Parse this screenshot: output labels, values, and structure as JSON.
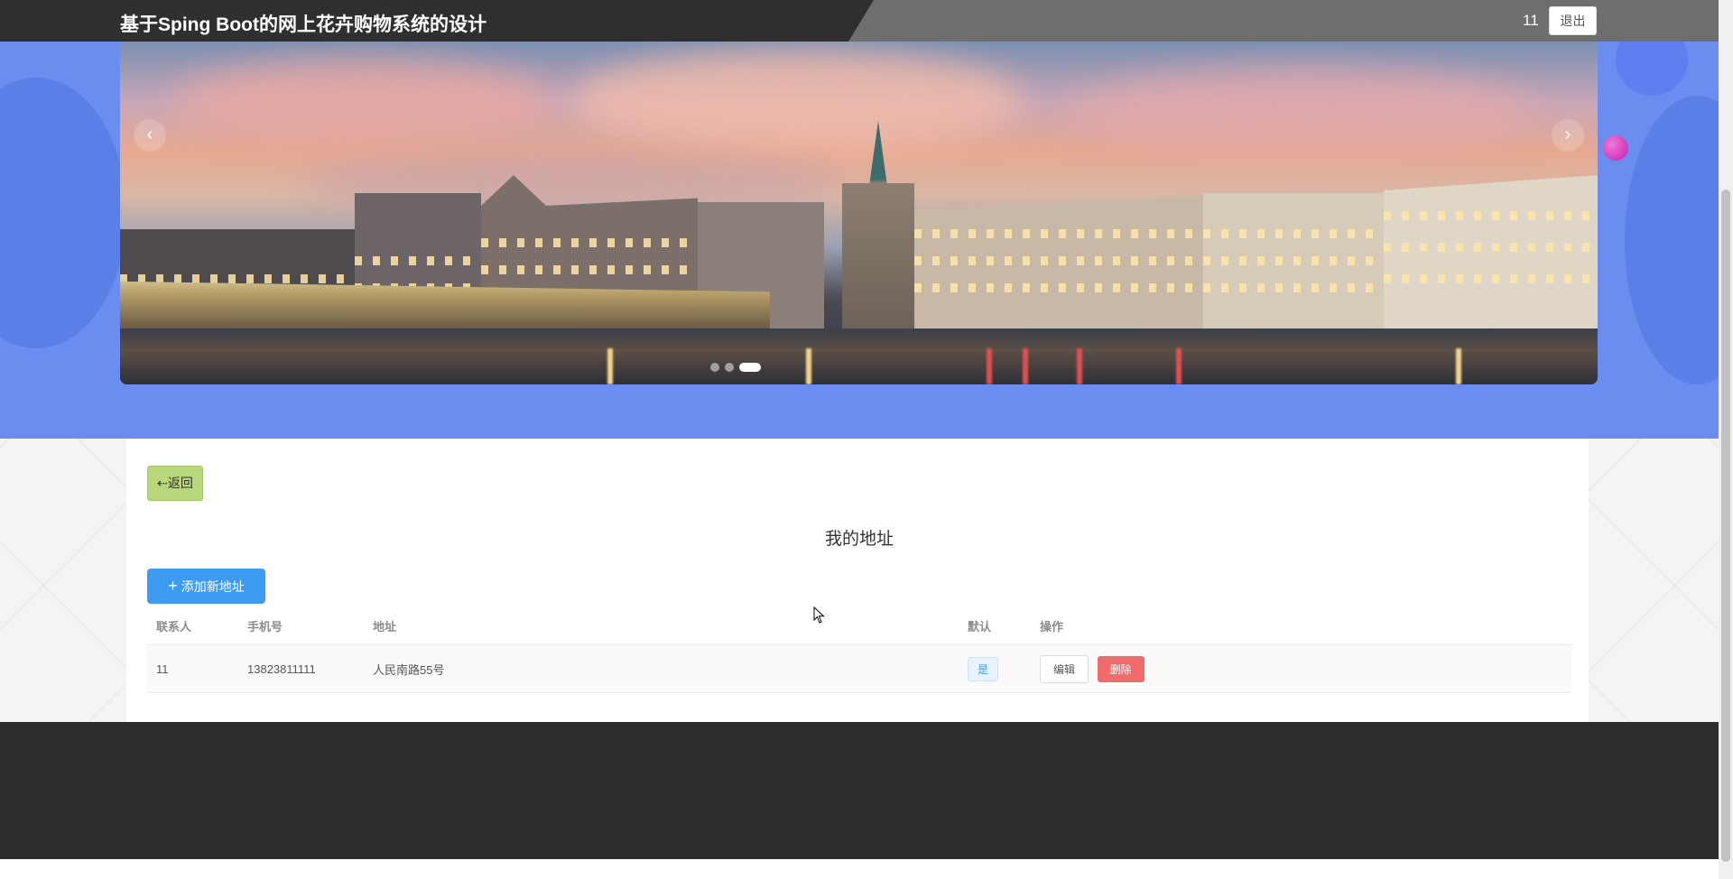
{
  "header": {
    "site_title": "基于Sping Boot的网上花卉购物系统的设计",
    "username": "11",
    "logout_label": "退出"
  },
  "carousel": {
    "prev_label": "‹",
    "next_label": "›",
    "slide_count": 3,
    "active_index": 2
  },
  "page": {
    "back_label": "⇠返回",
    "heading": "我的地址",
    "add_button_label": "添加新地址"
  },
  "table": {
    "columns": [
      "联系人",
      "手机号",
      "地址",
      "默认",
      "操作"
    ],
    "rows": [
      {
        "contact": "11",
        "phone": "13823811111",
        "address": "人民南路55号",
        "default_badge": "是",
        "edit_label": "编辑",
        "delete_label": "删除"
      }
    ]
  },
  "colors": {
    "header_bg": "#2f2f2f",
    "hero_bg": "#6b8def",
    "primary_button": "#3d9bf2",
    "back_button": "#b7d77a",
    "delete_button": "#f06b6b",
    "footer_bg": "#2e2e2e"
  }
}
